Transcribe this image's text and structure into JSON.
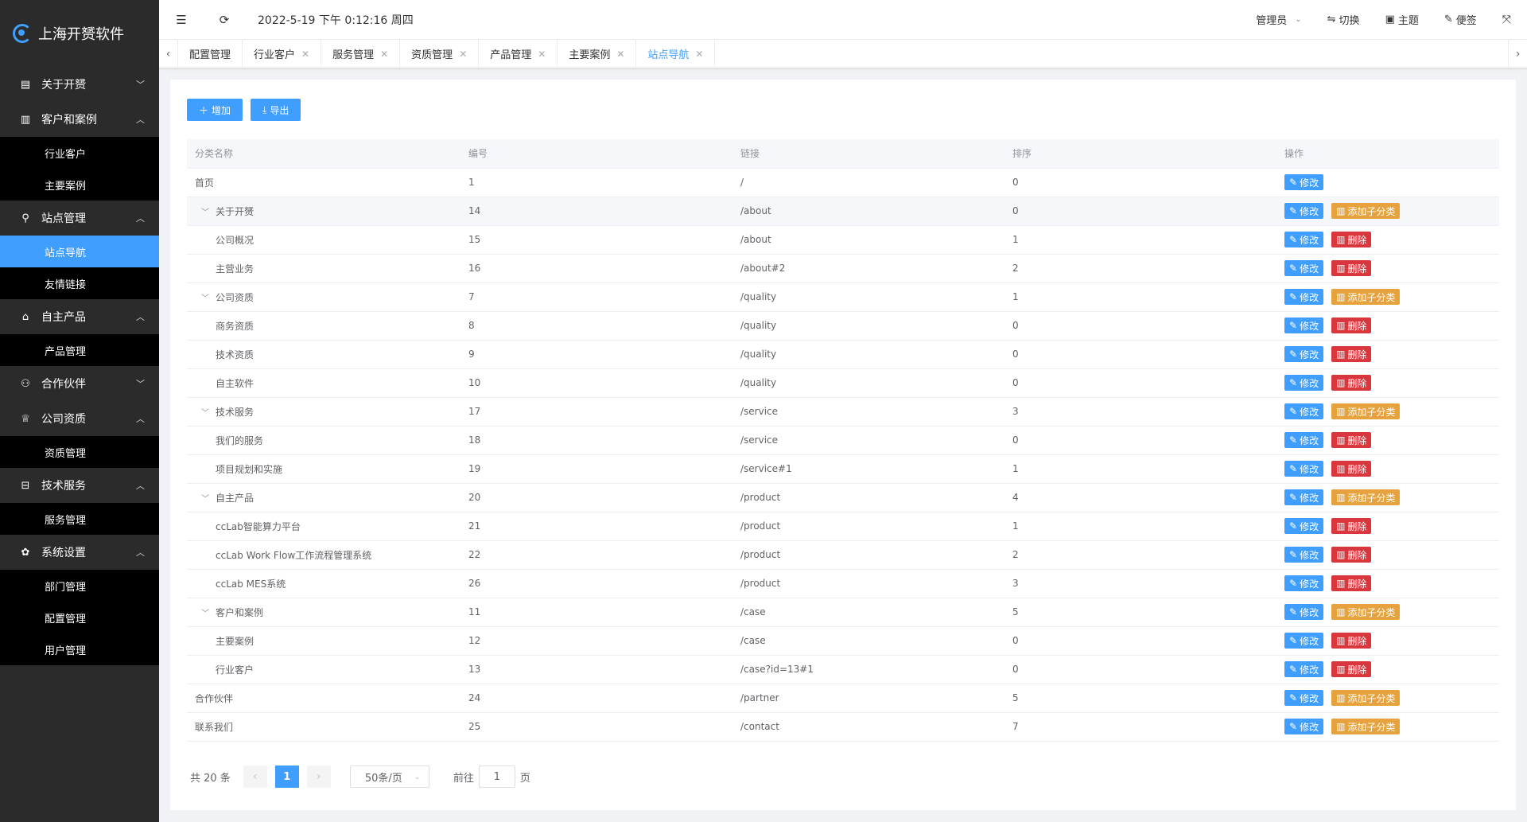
{
  "brand": {
    "name": "上海开赟软件"
  },
  "sidebar": {
    "groups": [
      {
        "label": "关于开赟",
        "icon": "info-icon",
        "expanded": false,
        "items": []
      },
      {
        "label": "客户和案例",
        "icon": "book-icon",
        "expanded": true,
        "items": [
          {
            "label": "行业客户"
          },
          {
            "label": "主要案例"
          }
        ]
      },
      {
        "label": "站点管理",
        "icon": "location-icon",
        "expanded": true,
        "items": [
          {
            "label": "站点导航",
            "active": true
          },
          {
            "label": "友情链接"
          }
        ]
      },
      {
        "label": "自主产品",
        "icon": "box-icon",
        "expanded": true,
        "items": [
          {
            "label": "产品管理"
          }
        ]
      },
      {
        "label": "合作伙伴",
        "icon": "user-icon",
        "expanded": false,
        "items": []
      },
      {
        "label": "公司资质",
        "icon": "trophy-icon",
        "expanded": true,
        "items": [
          {
            "label": "资质管理"
          }
        ]
      },
      {
        "label": "技术服务",
        "icon": "cart-icon",
        "expanded": true,
        "items": [
          {
            "label": "服务管理"
          }
        ]
      },
      {
        "label": "系统设置",
        "icon": "gear-icon",
        "expanded": true,
        "items": [
          {
            "label": "部门管理"
          },
          {
            "label": "配置管理"
          },
          {
            "label": "用户管理"
          }
        ]
      }
    ]
  },
  "header": {
    "datetime": "2022-5-19 下午 0:12:16 周四",
    "user": "管理员",
    "switch_label": "切换",
    "theme_label": "主题",
    "notes_label": "便签"
  },
  "tabs": [
    {
      "label": "配置管理",
      "closable": false,
      "active": false
    },
    {
      "label": "行业客户",
      "closable": true,
      "active": false
    },
    {
      "label": "服务管理",
      "closable": true,
      "active": false
    },
    {
      "label": "资质管理",
      "closable": true,
      "active": false
    },
    {
      "label": "产品管理",
      "closable": true,
      "active": false
    },
    {
      "label": "主要案例",
      "closable": true,
      "active": false
    },
    {
      "label": "站点导航",
      "closable": true,
      "active": true
    }
  ],
  "toolbar": {
    "add_label": "增加",
    "export_label": "导出"
  },
  "table": {
    "columns": [
      "分类名称",
      "编号",
      "链接",
      "排序",
      "操作"
    ],
    "edit_label": "修改",
    "add_child_label": "添加子分类",
    "delete_label": "删除",
    "rows": [
      {
        "name": "首页",
        "id": "1",
        "link": "/",
        "sort": "0",
        "level": 0,
        "expandable": false,
        "actions": [
          "edit"
        ]
      },
      {
        "name": "关于开赟",
        "id": "14",
        "link": "/about",
        "sort": "0",
        "level": 0,
        "expandable": true,
        "highlight": true,
        "actions": [
          "edit",
          "add"
        ]
      },
      {
        "name": "公司概况",
        "id": "15",
        "link": "/about",
        "sort": "1",
        "level": 1,
        "actions": [
          "edit",
          "del"
        ]
      },
      {
        "name": "主营业务",
        "id": "16",
        "link": "/about#2",
        "sort": "2",
        "level": 1,
        "actions": [
          "edit",
          "del"
        ]
      },
      {
        "name": "公司资质",
        "id": "7",
        "link": "/quality",
        "sort": "1",
        "level": 0,
        "expandable": true,
        "actions": [
          "edit",
          "add"
        ]
      },
      {
        "name": "商务资质",
        "id": "8",
        "link": "/quality",
        "sort": "0",
        "level": 1,
        "actions": [
          "edit",
          "del"
        ]
      },
      {
        "name": "技术资质",
        "id": "9",
        "link": "/quality",
        "sort": "0",
        "level": 1,
        "actions": [
          "edit",
          "del"
        ]
      },
      {
        "name": "自主软件",
        "id": "10",
        "link": "/quality",
        "sort": "0",
        "level": 1,
        "actions": [
          "edit",
          "del"
        ]
      },
      {
        "name": "技术服务",
        "id": "17",
        "link": "/service",
        "sort": "3",
        "level": 0,
        "expandable": true,
        "actions": [
          "edit",
          "add"
        ]
      },
      {
        "name": "我们的服务",
        "id": "18",
        "link": "/service",
        "sort": "0",
        "level": 1,
        "actions": [
          "edit",
          "del"
        ]
      },
      {
        "name": "项目规划和实施",
        "id": "19",
        "link": "/service#1",
        "sort": "1",
        "level": 1,
        "actions": [
          "edit",
          "del"
        ]
      },
      {
        "name": "自主产品",
        "id": "20",
        "link": "/product",
        "sort": "4",
        "level": 0,
        "expandable": true,
        "actions": [
          "edit",
          "add"
        ]
      },
      {
        "name": "ccLab智能算力平台",
        "id": "21",
        "link": "/product",
        "sort": "1",
        "level": 1,
        "actions": [
          "edit",
          "del"
        ]
      },
      {
        "name": "ccLab Work Flow工作流程管理系统",
        "id": "22",
        "link": "/product",
        "sort": "2",
        "level": 1,
        "actions": [
          "edit",
          "del"
        ]
      },
      {
        "name": "ccLab MES系统",
        "id": "26",
        "link": "/product",
        "sort": "3",
        "level": 1,
        "actions": [
          "edit",
          "del"
        ]
      },
      {
        "name": "客户和案例",
        "id": "11",
        "link": "/case",
        "sort": "5",
        "level": 0,
        "expandable": true,
        "actions": [
          "edit",
          "add"
        ]
      },
      {
        "name": "主要案例",
        "id": "12",
        "link": "/case",
        "sort": "0",
        "level": 1,
        "actions": [
          "edit",
          "del"
        ]
      },
      {
        "name": "行业客户",
        "id": "13",
        "link": "/case?id=13#1",
        "sort": "0",
        "level": 1,
        "actions": [
          "edit",
          "del"
        ]
      },
      {
        "name": "合作伙伴",
        "id": "24",
        "link": "/partner",
        "sort": "5",
        "level": 0,
        "expandable": false,
        "actions": [
          "edit",
          "add"
        ]
      },
      {
        "name": "联系我们",
        "id": "25",
        "link": "/contact",
        "sort": "7",
        "level": 0,
        "expandable": false,
        "actions": [
          "edit",
          "add"
        ]
      }
    ]
  },
  "pagination": {
    "total_text": "共 20 条",
    "current_page": "1",
    "page_size": "50条/页",
    "goto_label": "前往",
    "goto_value": "1",
    "page_suffix": "页"
  },
  "colors": {
    "primary": "#409eff",
    "warning": "#e6a23c",
    "danger": "#d9363e",
    "sidebar_bg": "#2b2b2b",
    "submenu_bg": "#000000"
  }
}
